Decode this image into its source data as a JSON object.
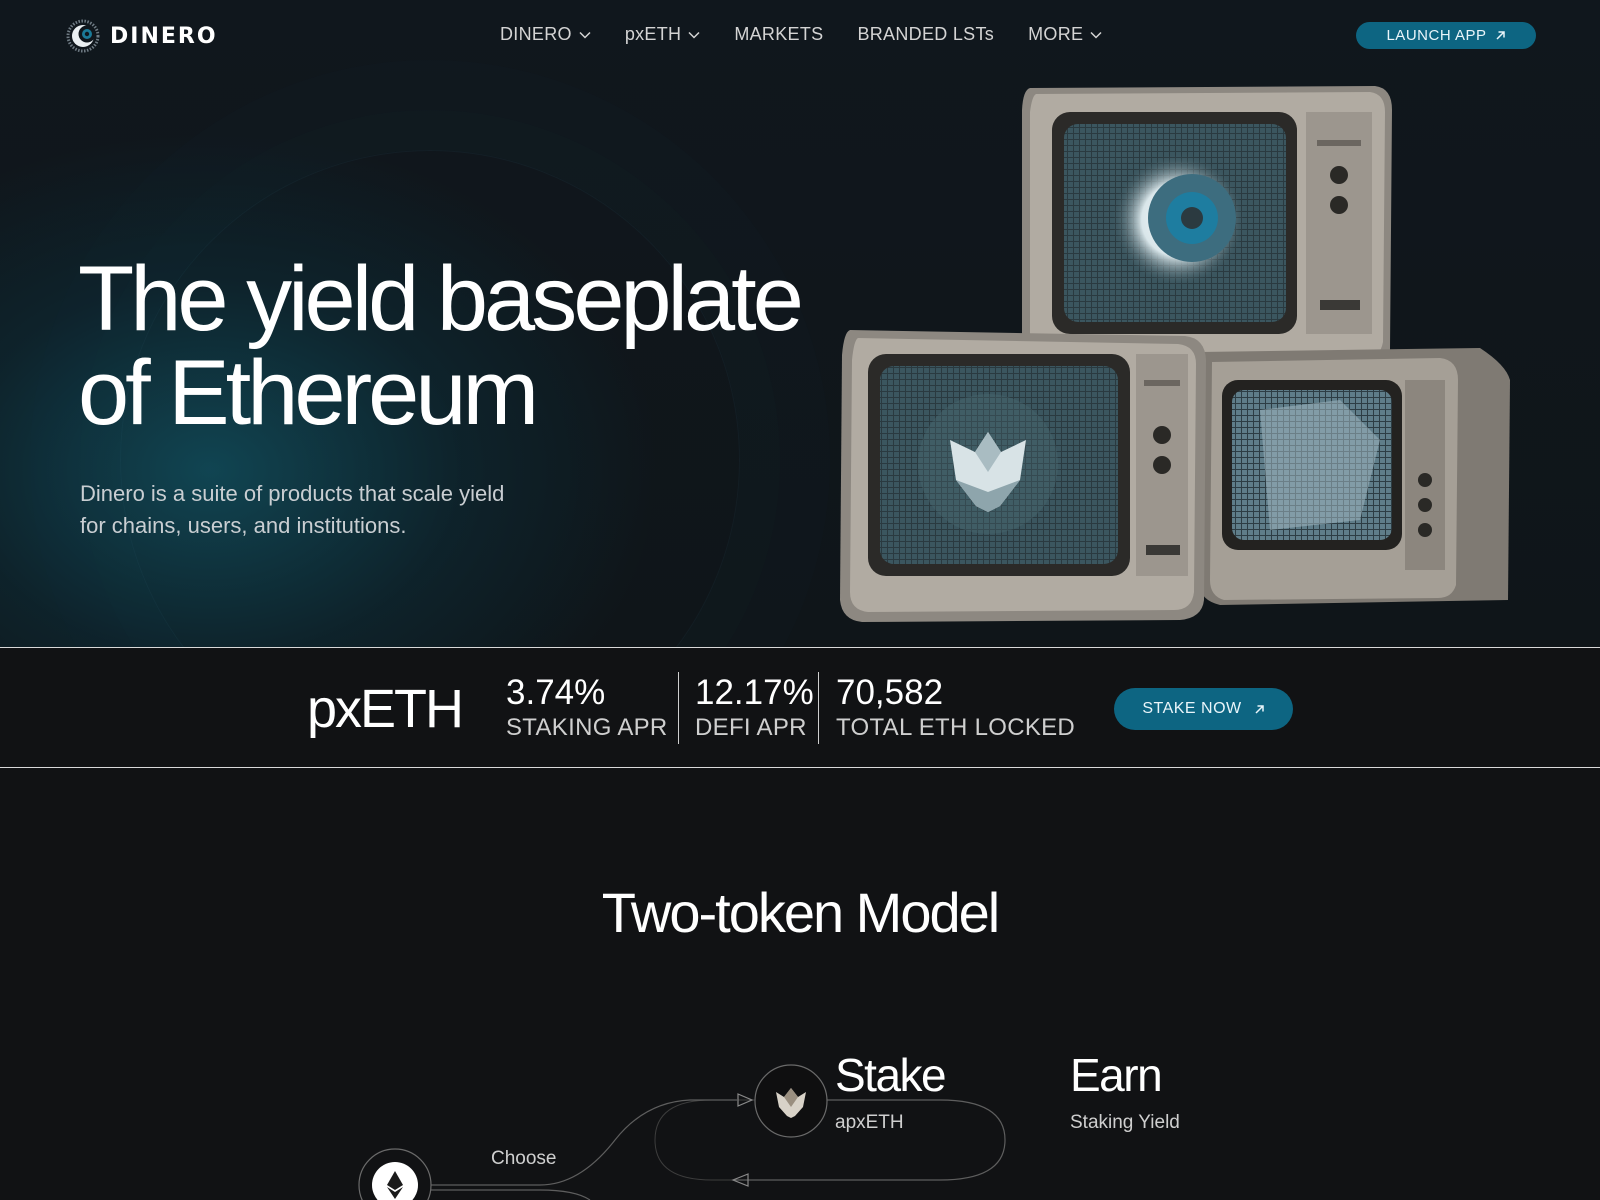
{
  "nav": {
    "brand": "DINERO",
    "items": [
      {
        "label": "DINERO",
        "has_dropdown": true
      },
      {
        "label": "pxETH",
        "has_dropdown": true
      },
      {
        "label": "MARKETS",
        "has_dropdown": false
      },
      {
        "label": "BRANDED LSTs",
        "has_dropdown": false
      },
      {
        "label": "MORE",
        "has_dropdown": true
      }
    ],
    "launch_label": "LAUNCH APP"
  },
  "hero": {
    "headline_line1": "The yield baseplate",
    "headline_line2": "of Ethereum",
    "subtext": "Dinero is a suite of products that scale yield for chains, users, and institutions."
  },
  "stats": {
    "token": "pxETH",
    "items": [
      {
        "value": "3.74%",
        "label": "STAKING APR"
      },
      {
        "value": "12.17%",
        "label": "DEFI APR"
      },
      {
        "value": "70,582",
        "label": "TOTAL ETH LOCKED"
      }
    ],
    "cta_label": "STAKE NOW"
  },
  "model": {
    "title": "Two-token Model",
    "stake_title": "Stake",
    "stake_token": "apxETH",
    "earn_title": "Earn",
    "earn_sub": "Staking Yield",
    "choose_label": "Choose"
  },
  "colors": {
    "accent": "#0d6582",
    "background": "#111214",
    "hero_glow": "#114d5c"
  },
  "icons": [
    "dinero-logo-icon",
    "chevron-down-icon",
    "arrow-up-right-icon",
    "ethereum-icon",
    "pxeth-crown-icon"
  ]
}
